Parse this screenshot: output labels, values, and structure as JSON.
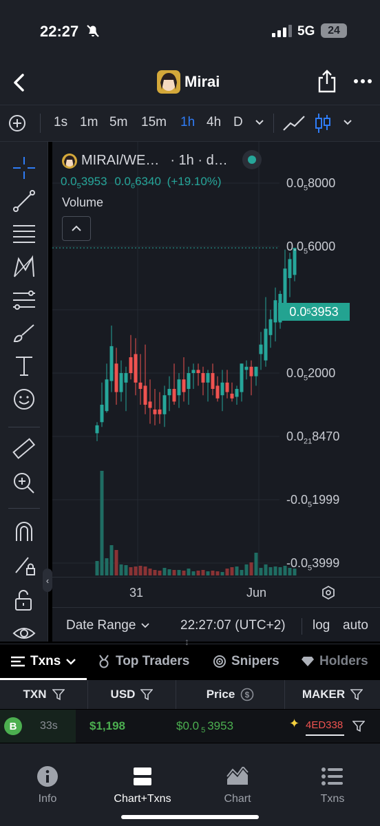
{
  "status_bar": {
    "time": "22:27",
    "network": "5G",
    "battery": "24"
  },
  "nav": {
    "title": "Mirai"
  },
  "timeframes": {
    "plus": "⊕",
    "items": [
      "1s",
      "1m",
      "5m",
      "15m",
      "1h",
      "4h",
      "D"
    ],
    "active": "1h"
  },
  "legend": {
    "pair": "MIRAI/WE…",
    "interval": "· 1h · d…",
    "open_sub": "5",
    "open_tail": "3953",
    "price_sub": "6",
    "price_tail": "6340",
    "change": "(+19.10%)",
    "prefix": "0.0",
    "volume_label": "Volume"
  },
  "y_axis": [
    {
      "pre": "0.0",
      "sub": "5",
      "tail": "8000"
    },
    {
      "pre": "0.0",
      "sub": "5",
      "tail": "6000"
    },
    {
      "pre": "0.0",
      "sub": "5",
      "tail": "2000"
    },
    {
      "pre": "0.0",
      "sub": "21",
      "tail": "8470"
    },
    {
      "pre": "-0.0",
      "sub": "5",
      "tail": "1999"
    },
    {
      "pre": "-0.0",
      "sub": "5",
      "tail": "3999"
    }
  ],
  "last_price": {
    "pre": "0.0",
    "sub": "5",
    "tail": "3953"
  },
  "x_axis": {
    "labels": [
      "31",
      "Jun"
    ]
  },
  "chart_footer": {
    "date_range": "Date Range",
    "time": "22:27:07 (UTC+2)",
    "log": "log",
    "auto": "auto"
  },
  "tabs": [
    "Txns",
    "Top Traders",
    "Snipers",
    "Holders"
  ],
  "table": {
    "columns": [
      "TXN",
      "USD",
      "Price",
      "MAKER"
    ],
    "rows": [
      {
        "type": "B",
        "age": "33s",
        "usd": "$1,198",
        "price_pre": "$0.0",
        "price_sub": "5",
        "price_tail": "3953",
        "maker": "4ED338"
      }
    ]
  },
  "bottom_nav": [
    "Info",
    "Chart+Txns",
    "Chart",
    "Txns"
  ],
  "colors": {
    "up": "#26a69a",
    "down": "#ef5350",
    "accent": "#2f7cf6",
    "bg": "#181b22"
  },
  "chart_data": {
    "type": "candlestick",
    "interval": "1h",
    "y_ticks": [
      "0.0₅8000",
      "0.0₅6000",
      "0.0₅2000",
      "0.0₂₁8470",
      "-0.0₅1999",
      "-0.0₅3999"
    ],
    "last_price": "0.0₅3953",
    "candles": [
      {
        "o": -1.9,
        "h": -1.55,
        "l": -2.15,
        "c": -1.65
      },
      {
        "o": -1.55,
        "h": -0.3,
        "l": -1.7,
        "c": -1.0
      },
      {
        "o": -1.2,
        "h": 0.3,
        "l": -1.25,
        "c": -0.2
      },
      {
        "o": -0.25,
        "h": 1.5,
        "l": -0.6,
        "c": 0.85
      },
      {
        "o": 0.3,
        "h": 0.8,
        "l": -1.0,
        "c": -0.6
      },
      {
        "o": -0.6,
        "h": 0.4,
        "l": -0.9,
        "c": 0.0
      },
      {
        "o": -0.3,
        "h": 0.2,
        "l": -1.2,
        "c": 0.0
      },
      {
        "o": 0.5,
        "h": 1.2,
        "l": -0.2,
        "c": 0.0
      },
      {
        "o": 0.6,
        "h": 1.1,
        "l": -0.7,
        "c": -0.3
      },
      {
        "o": -0.3,
        "h": 0.6,
        "l": -1.0,
        "c": -0.5
      },
      {
        "o": -0.4,
        "h": 0.9,
        "l": -1.3,
        "c": -1.0
      },
      {
        "o": -0.9,
        "h": -0.2,
        "l": -1.6,
        "c": -1.1
      },
      {
        "o": -1.15,
        "h": -0.5,
        "l": -1.65,
        "c": -1.3
      },
      {
        "o": -1.15,
        "h": -0.6,
        "l": -1.6,
        "c": -1.3
      },
      {
        "o": -1.3,
        "h": -0.4,
        "l": -1.7,
        "c": -0.7
      },
      {
        "o": -0.7,
        "h": -0.1,
        "l": -1.2,
        "c": -0.5
      },
      {
        "o": -0.5,
        "h": 0.3,
        "l": -1.0,
        "c": -0.9
      },
      {
        "o": -0.7,
        "h": 0.0,
        "l": -1.1,
        "c": -0.2
      },
      {
        "o": -0.2,
        "h": 0.5,
        "l": -0.9,
        "c": -0.6
      },
      {
        "o": -0.5,
        "h": 0.2,
        "l": -1.0,
        "c": 0.0
      },
      {
        "o": 0.0,
        "h": 0.3,
        "l": -0.5,
        "c": 0.1
      },
      {
        "o": 0.1,
        "h": 0.3,
        "l": -0.4,
        "c": 0.0
      },
      {
        "o": 0.0,
        "h": 0.2,
        "l": -0.7,
        "c": -0.3
      },
      {
        "o": -0.3,
        "h": 0.1,
        "l": -0.9,
        "c": 0.0
      },
      {
        "o": 0.0,
        "h": 0.3,
        "l": -0.7,
        "c": -0.5
      },
      {
        "o": -0.4,
        "h": -0.1,
        "l": -0.9,
        "c": -0.8
      },
      {
        "o": -0.7,
        "h": 0.1,
        "l": -1.2,
        "c": -0.3
      },
      {
        "o": -0.3,
        "h": 0.1,
        "l": -0.8,
        "c": -0.6
      },
      {
        "o": -0.65,
        "h": -0.3,
        "l": -0.9,
        "c": -0.8
      },
      {
        "o": -0.75,
        "h": -0.4,
        "l": -1.0,
        "c": -0.5
      },
      {
        "o": -0.6,
        "h": 0.3,
        "l": -0.9,
        "c": 0.3
      },
      {
        "o": 0.1,
        "h": 0.4,
        "l": -0.2,
        "c": 0.2
      },
      {
        "o": 0.2,
        "h": 0.4,
        "l": -0.7,
        "c": -0.1
      },
      {
        "o": -0.1,
        "h": 0.2,
        "l": -0.4,
        "c": 0.2
      },
      {
        "o": 0.6,
        "h": 1.3,
        "l": 0.1,
        "c": 0.9
      },
      {
        "o": 0.4,
        "h": 2.4,
        "l": 0.2,
        "c": 1.4
      },
      {
        "o": 1.2,
        "h": 2.0,
        "l": 0.8,
        "c": 1.7
      },
      {
        "o": 1.6,
        "h": 2.7,
        "l": 1.0,
        "c": 2.3
      },
      {
        "o": 1.6,
        "h": 2.6,
        "l": 1.4,
        "c": 2.5
      },
      {
        "o": 2.0,
        "h": 3.9,
        "l": 1.7,
        "c": 3.3
      },
      {
        "o": 3.0,
        "h": 3.8,
        "l": 2.4,
        "c": 3.6
      },
      {
        "o": 3.1,
        "h": 3.95,
        "l": 2.9,
        "c": 3.953
      }
    ],
    "volumes": [
      2.1,
      15.2,
      2.5,
      4.4,
      3.7,
      1.6,
      1.5,
      1.2,
      1.3,
      1.4,
      1.3,
      1.0,
      0.8,
      0.7,
      1.1,
      0.9,
      0.8,
      0.8,
      0.7,
      1.0,
      0.6,
      0.7,
      0.8,
      0.6,
      0.7,
      0.6,
      0.5,
      1.0,
      1.2,
      1.3,
      0.8,
      1.6,
      1.9,
      3.3,
      1.1,
      1.6,
      1.2,
      1.3,
      1.2,
      1.4,
      1.1,
      1.0
    ]
  }
}
